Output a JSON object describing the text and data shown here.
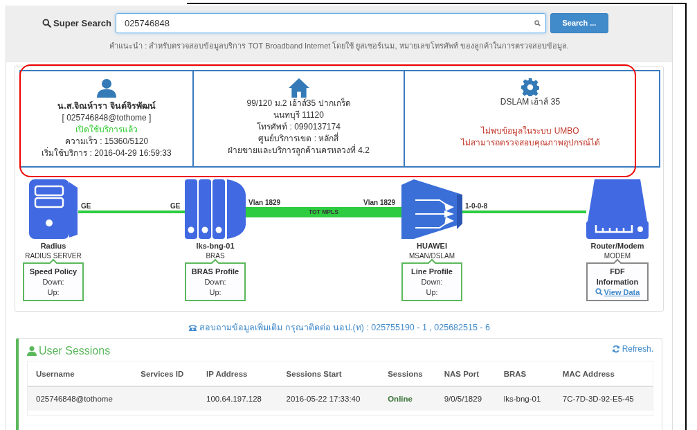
{
  "search": {
    "label": "Super Search",
    "value": "025746848",
    "button": "Search ...",
    "hint": "คำแนะนำ : สำหรับตรวจสอบข้อมูลบริการ TOT Broadband Internet โดยใช้ ยูสเซอร์เนม, หมายเลขโทรศัพท์ ของลูกค้าในการตรวจสอบข้อมูล."
  },
  "info_boxes": [
    {
      "kind": "person",
      "lines": [
        {
          "kind": "name",
          "text": "น.ส.จิณห์ารา จินต์จิรพัฒน์"
        },
        {
          "kind": "normal",
          "text": "[ 025746848@tothome ]"
        },
        {
          "kind": "status",
          "text": "เปิดใช้บริการแล้ว"
        },
        {
          "kind": "normal",
          "text": "ความเร็ว : 15360/5120"
        },
        {
          "kind": "normal",
          "text": "เริ่มใช้บริการ : 2016-04-29 16:59:33"
        }
      ]
    },
    {
      "kind": "address",
      "lines": [
        {
          "kind": "normal",
          "text": "99/120 ม.2 เอ้าส์35 ปากเกร็ด"
        },
        {
          "kind": "normal",
          "text": "นนทบุรี 11120"
        },
        {
          "kind": "normal",
          "text": "โทรศัพท์ : 0990137174"
        },
        {
          "kind": "normal",
          "text": "ศูนย์บริการเขต : หลักสี่"
        },
        {
          "kind": "normal",
          "text": "ฝ่ายขายและบริการลูกค้านครหลวงที่ 4.2"
        }
      ]
    },
    {
      "kind": "device",
      "lines": [
        {
          "kind": "normal",
          "text": "DSLAM เอ้าส์ 35"
        },
        {
          "kind": "error",
          "text": "ไม่พบข้อมูลในระบบ UMBO"
        },
        {
          "kind": "error",
          "text": "ไม่สามารถตรวจสอบคุณภาพอุปกรณ์ได้"
        }
      ]
    }
  ],
  "diagram": {
    "nodes": [
      {
        "kind": "server",
        "name": "Radius",
        "type": "RADIUS SERVER",
        "box": {
          "kind": "profile",
          "title": "Speed Policy",
          "lines": [
            "Down:",
            "Up:"
          ]
        }
      },
      {
        "kind": "bras",
        "name": "lks-bng-01",
        "type": "BRAS",
        "box": {
          "kind": "profile",
          "title": "BRAS Profile",
          "lines": [
            "Down:",
            "Up:"
          ]
        }
      },
      {
        "kind": "msan",
        "name": "HUAWEI",
        "type": "MSAN/DSLAM",
        "box": {
          "kind": "profile",
          "title": "Line Profile",
          "lines": [
            "Down:",
            "Up:"
          ]
        }
      },
      {
        "kind": "modem",
        "name": "Router/Modem",
        "type": "MODEM",
        "box": {
          "kind": "info",
          "title": "FDF Information",
          "link": "View Data"
        }
      }
    ],
    "links": [
      {
        "kind": "thin",
        "left": "GE",
        "right": "GE"
      },
      {
        "kind": "thick",
        "left": "Vlan 1829",
        "right": "Vlan 1829",
        "middle": "TOT MPLS"
      },
      {
        "kind": "thin",
        "left": "1-0-0-8"
      }
    ]
  },
  "contact": "สอบถามข้อมูลเพิ่มเติม กรุณาติดต่อ นอป.(ท) : 025755190 - 1 , 025682515 - 6",
  "sessions": {
    "title": "User Sessions",
    "refresh": "Refresh.",
    "columns": [
      {
        "label": "Username",
        "kind": "text"
      },
      {
        "label": "Services ID",
        "kind": "text"
      },
      {
        "label": "IP Address",
        "kind": "text"
      },
      {
        "label": "Sessions Start",
        "kind": "text"
      },
      {
        "label": "Sessions",
        "kind": "status"
      },
      {
        "label": "NAS Port",
        "kind": "text"
      },
      {
        "label": "BRAS",
        "kind": "text"
      },
      {
        "label": "MAC Address",
        "kind": "text"
      }
    ],
    "rows": [
      [
        "025746848@tothome",
        "",
        "100.64.197.128",
        "2016-05-22 17:33:40",
        "Online",
        "9/0/5/1829",
        "lks-bng-01",
        "7C-7D-3D-92-E5-45"
      ]
    ]
  }
}
